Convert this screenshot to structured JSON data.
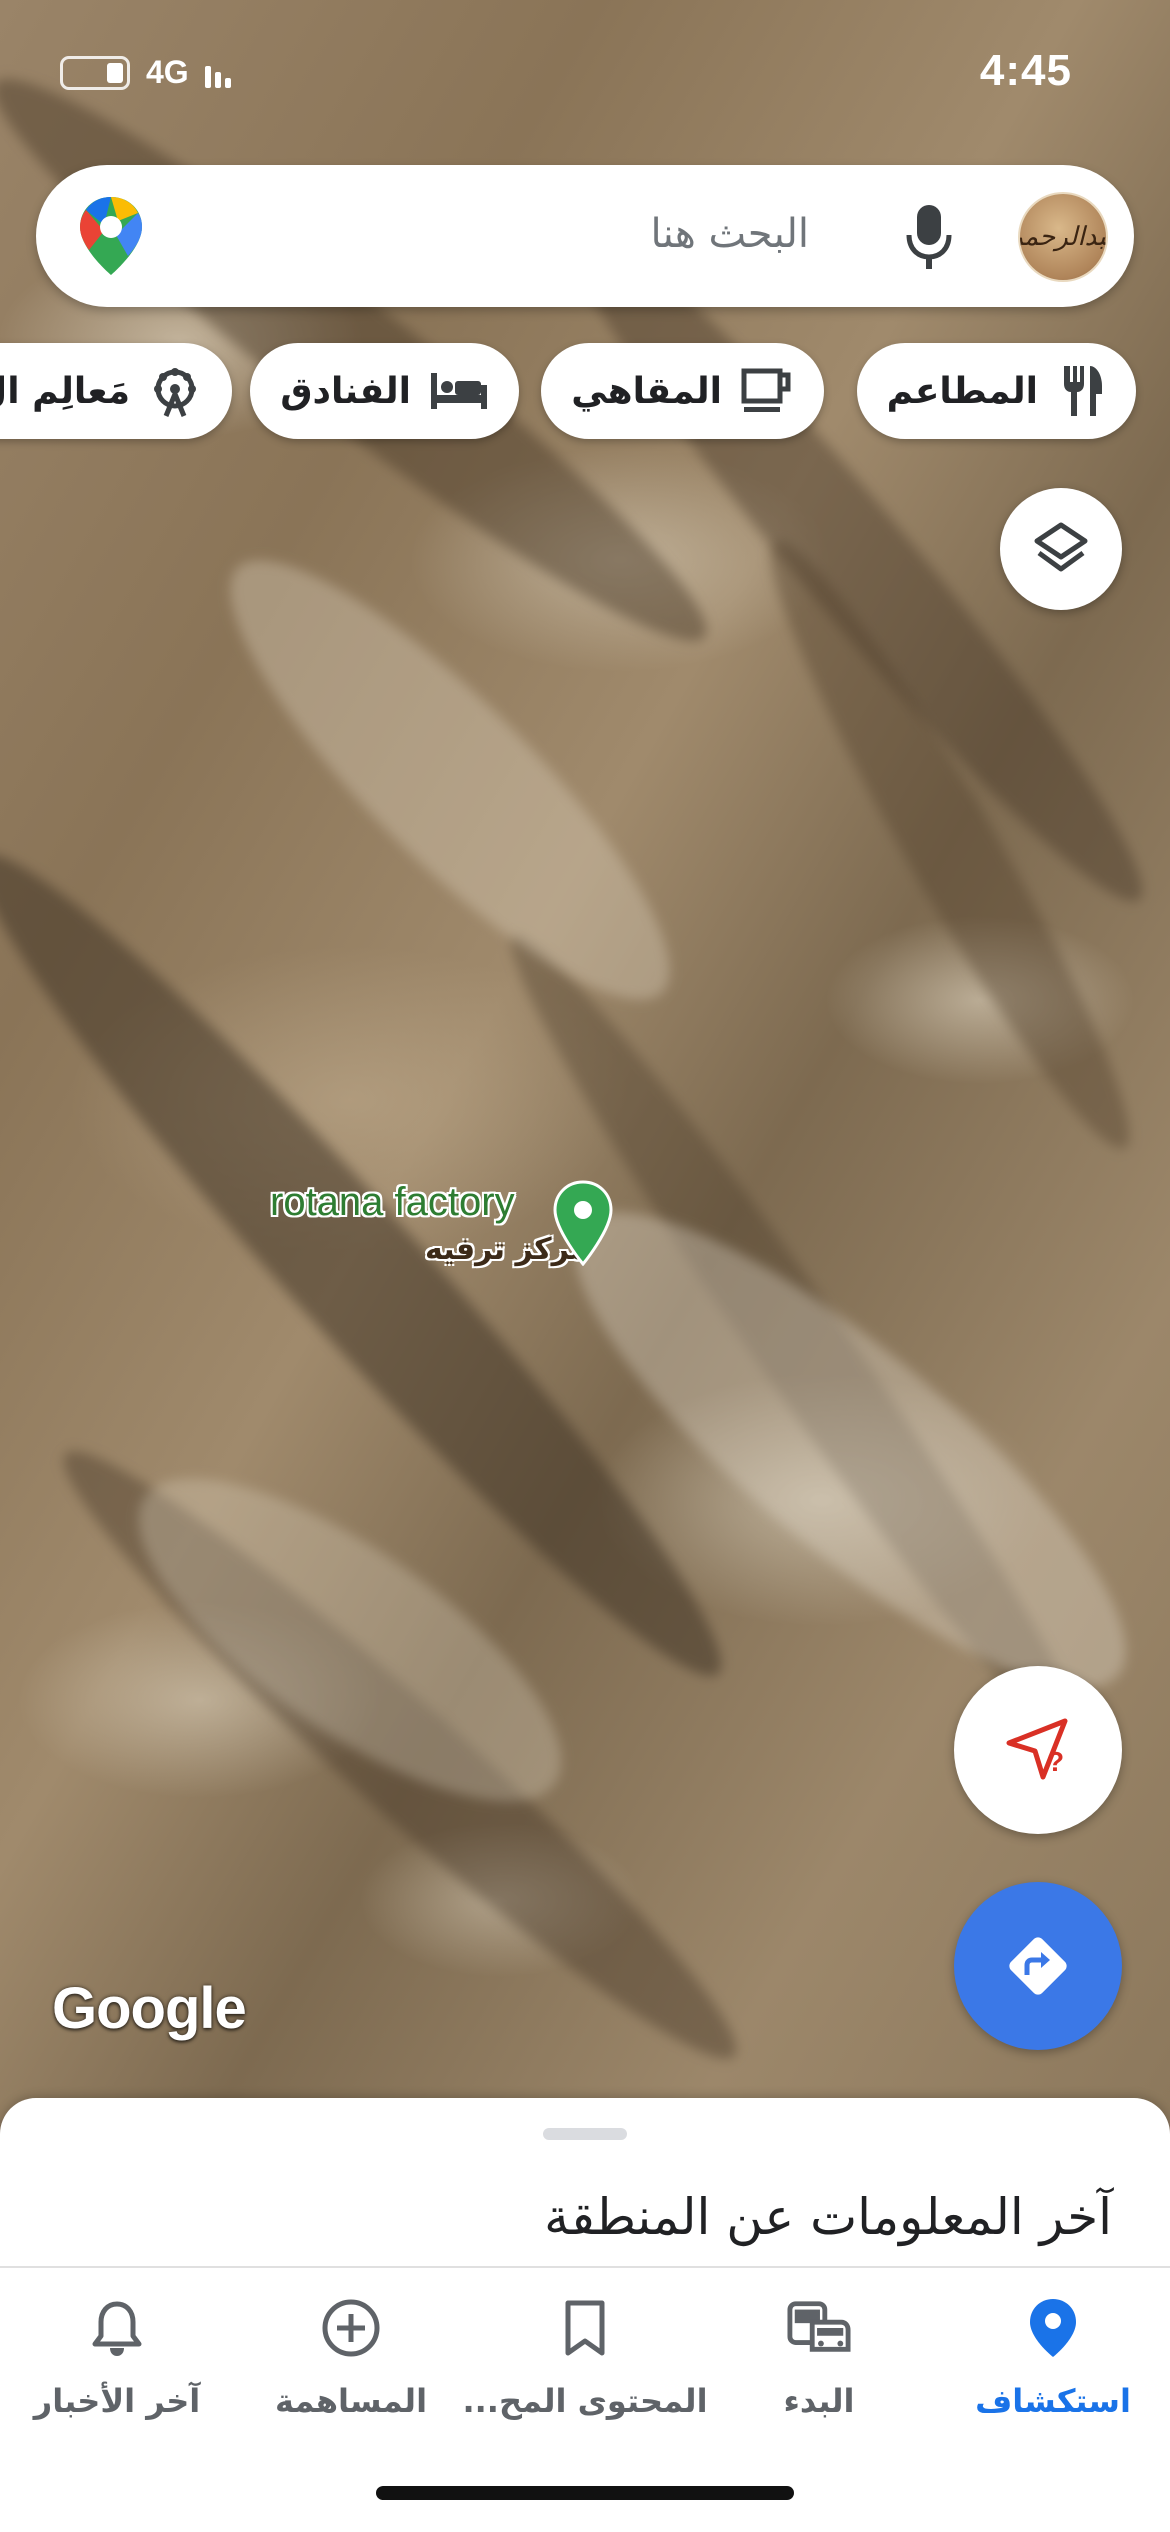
{
  "status_bar": {
    "time": "4:45",
    "network": "4G"
  },
  "search": {
    "placeholder": "البحث هنا",
    "avatar_text": "عبدالرحمن"
  },
  "chips": [
    {
      "label": "المطاعم",
      "icon": "restaurant-icon"
    },
    {
      "label": "المقاهي",
      "icon": "coffee-icon"
    },
    {
      "label": "الفنادق",
      "icon": "hotel-icon"
    },
    {
      "label": "مَعالِم ال",
      "icon": "attractions-icon"
    }
  ],
  "map": {
    "place_name": "rotana factory",
    "place_category": "مركز ترفيه",
    "attribution": "Google"
  },
  "sheet": {
    "title": "آخر المعلومات عن المنطقة"
  },
  "nav": [
    {
      "label": "استكشاف",
      "icon": "explore-pin-icon",
      "active": true
    },
    {
      "label": "البدء",
      "icon": "commute-icon",
      "active": false
    },
    {
      "label": "المحتوى المح...",
      "icon": "saved-bookmark-icon",
      "active": false
    },
    {
      "label": "المساهمة",
      "icon": "contribute-plus-icon",
      "active": false
    },
    {
      "label": "آخر الأخبار",
      "icon": "updates-bell-icon",
      "active": false
    }
  ],
  "colors": {
    "accent": "#1a73e8",
    "directions_button": "#3b78e7",
    "pin": "#34a853"
  }
}
